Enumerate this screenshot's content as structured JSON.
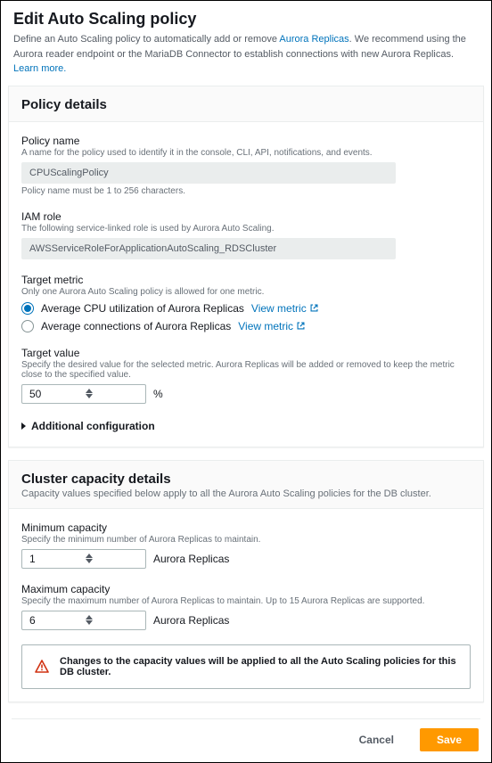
{
  "title": "Edit Auto Scaling policy",
  "intro_a": "Define an Auto Scaling policy to automatically add or remove ",
  "intro_link1": "Aurora Replicas",
  "intro_b": ". We recommend using the Aurora reader endpoint or the MariaDB Connector to establish connections with new Aurora Replicas. ",
  "intro_link2": "Learn more.",
  "policy": {
    "heading": "Policy details",
    "name_label": "Policy name",
    "name_hint": "A name for the policy used to identify it in the console, CLI, API, notifications, and events.",
    "name_value": "CPUScalingPolicy",
    "name_helper": "Policy name must be 1 to 256 characters.",
    "iam_label": "IAM role",
    "iam_hint": "The following service-linked role is used by Aurora Auto Scaling.",
    "iam_value": "AWSServiceRoleForApplicationAutoScaling_RDSCluster",
    "metric_label": "Target metric",
    "metric_hint": "Only one Aurora Auto Scaling policy is allowed for one metric.",
    "metric_cpu": "Average CPU utilization of Aurora Replicas",
    "metric_conn": "Average connections of Aurora Replicas",
    "view_metric": "View metric",
    "tv_label": "Target value",
    "tv_hint": "Specify the desired value for the selected metric. Aurora Replicas will be added or removed to keep the metric close to the specified value.",
    "tv_value": "50",
    "tv_unit": "%",
    "addl": "Additional configuration"
  },
  "cap": {
    "heading": "Cluster capacity details",
    "sub": "Capacity values specified below apply to all the Aurora Auto Scaling policies for the DB cluster.",
    "min_label": "Minimum capacity",
    "min_hint": "Specify the minimum number of Aurora Replicas to maintain.",
    "min_value": "1",
    "max_label": "Maximum capacity",
    "max_hint": "Specify the maximum number of Aurora Replicas to maintain. Up to 15 Aurora Replicas are supported.",
    "max_value": "6",
    "unit": "Aurora Replicas",
    "warn": "Changes to the capacity values will be applied to all the Auto Scaling policies for this DB cluster."
  },
  "actions": {
    "cancel": "Cancel",
    "save": "Save"
  }
}
